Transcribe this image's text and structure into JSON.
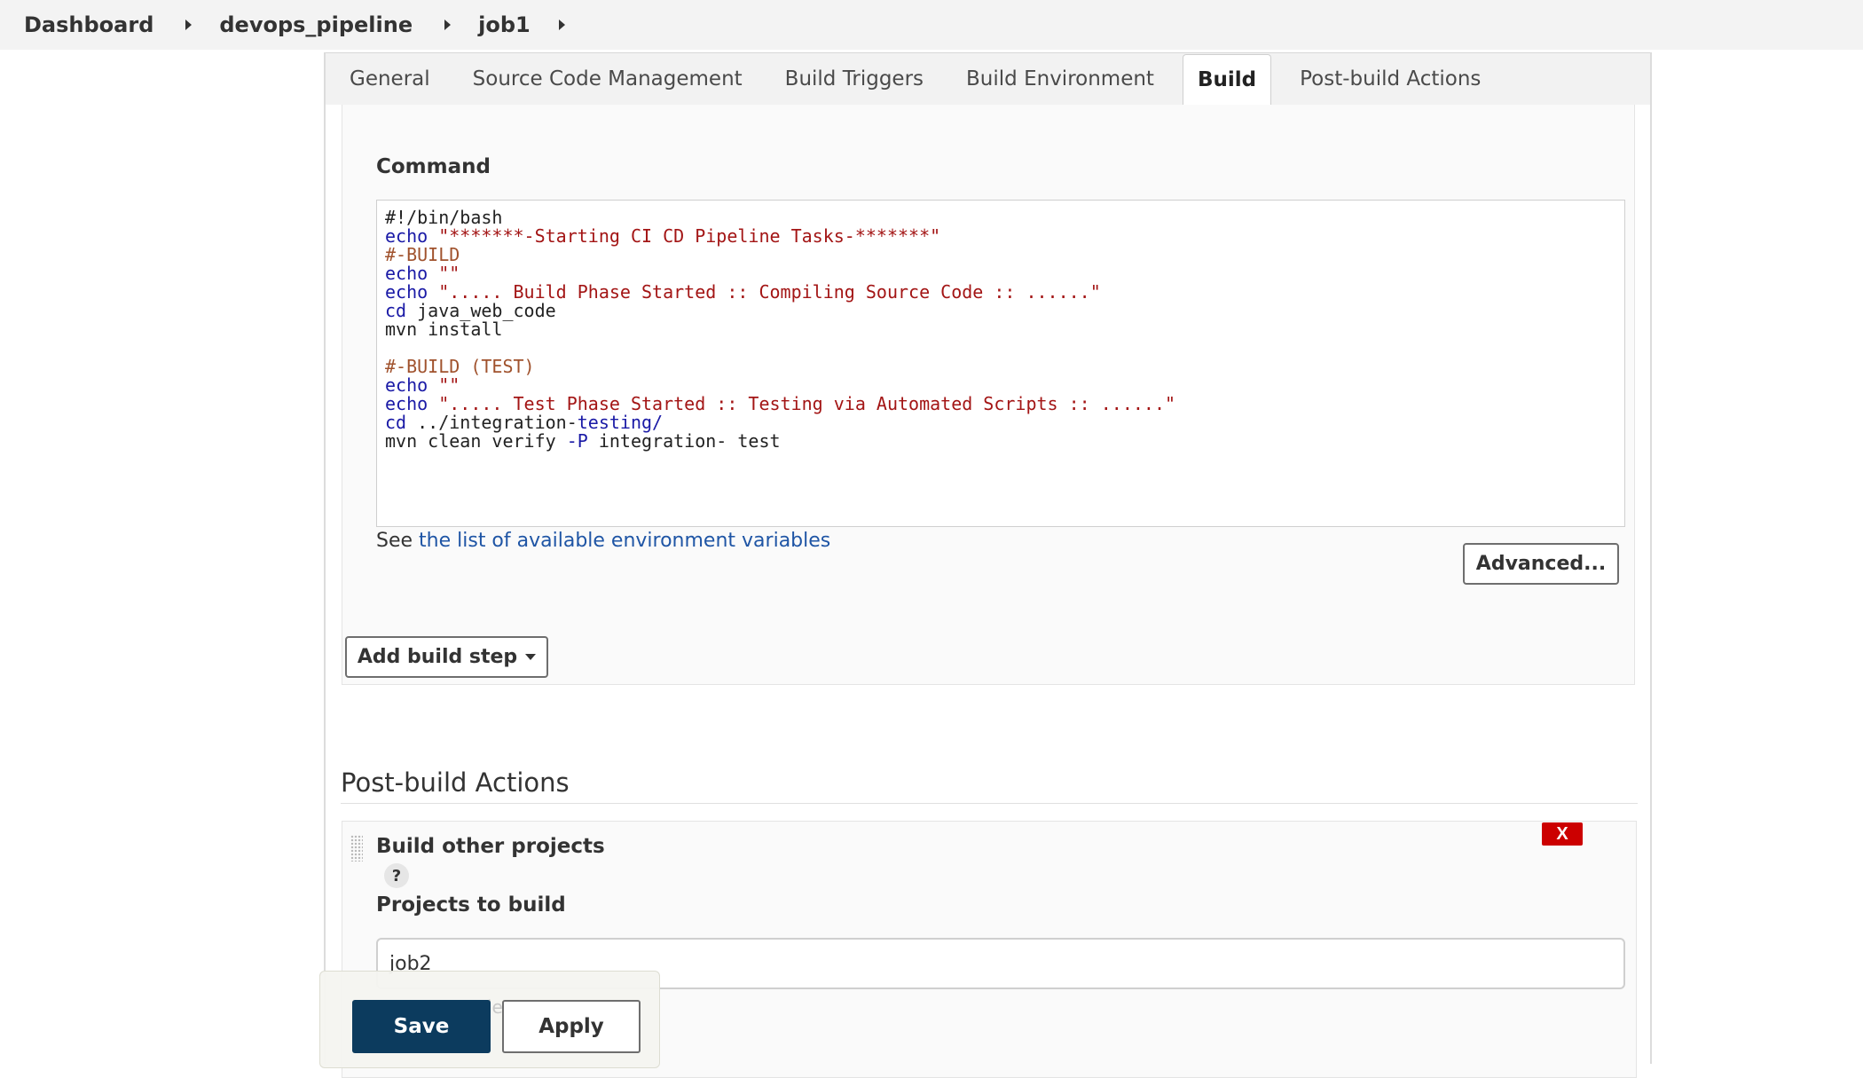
{
  "breadcrumb": [
    "Dashboard",
    "devops_pipeline",
    "job1"
  ],
  "tabs": [
    "General",
    "Source Code Management",
    "Build Triggers",
    "Build Environment",
    "Build",
    "Post-build Actions"
  ],
  "active_tab": "Build",
  "build_step": {
    "command_label": "Command",
    "script_lines": [
      "#!/bin/bash",
      "echo \"*******-Starting CI CD Pipeline Tasks-*******\"",
      "#-BUILD",
      "echo \"\"",
      "echo \"..... Build Phase Started :: Compiling Source Code :: ......\"",
      "cd java_web_code",
      "mvn install",
      "",
      "#-BUILD (TEST)",
      "echo \"\"",
      "echo \"..... Test Phase Started :: Testing via Automated Scripts :: ......\"",
      "cd ../integration-testing/",
      "mvn clean verify -P integration- test"
    ],
    "hint_prefix": "See ",
    "hint_link": "the list of available environment variables",
    "advanced_label": "Advanced..."
  },
  "add_build_step_label": "Add build step",
  "post_build": {
    "heading": "Post-build Actions",
    "action_title": "Build other projects",
    "delete_label": "X",
    "help_label": "?",
    "projects_label": "Projects to build",
    "projects_value": "job2"
  },
  "footer": {
    "save_label": "Save",
    "apply_label": "Apply",
    "ghost_text": "le"
  }
}
